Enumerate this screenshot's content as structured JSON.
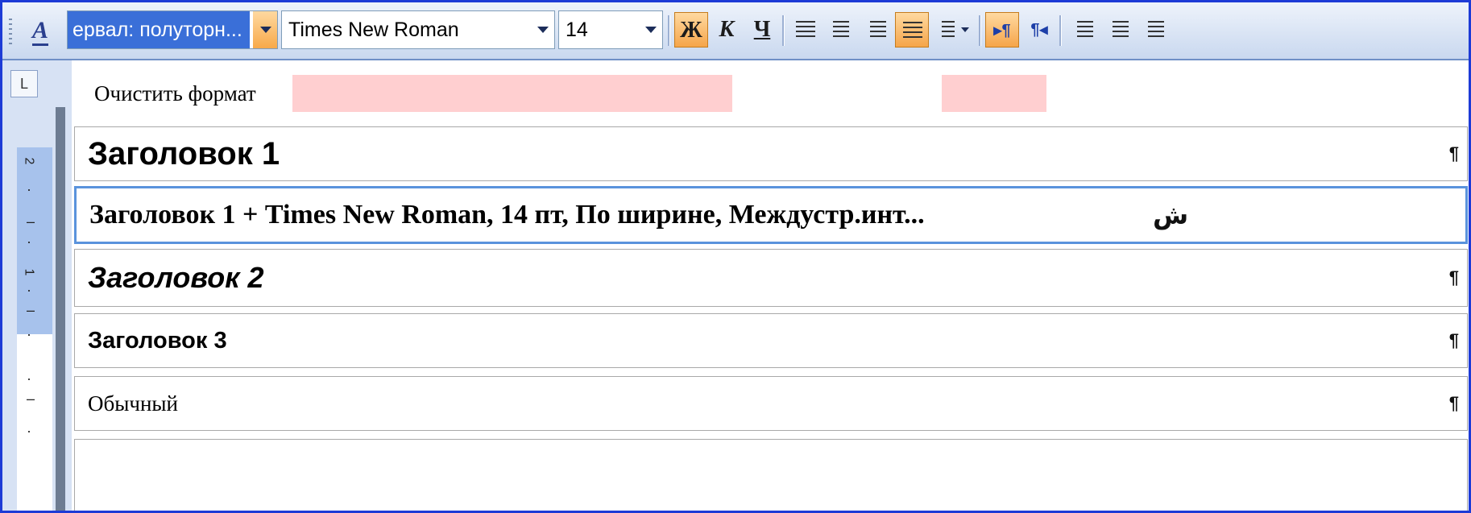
{
  "toolbar": {
    "style_value": "ервал: полуторн...",
    "font_value": "Times New Roman",
    "size_value": "14",
    "bold_label": "Ж",
    "italic_label": "К",
    "underline_label": "Ч",
    "ltr_label": "▸¶",
    "rtl_label": "¶◂",
    "styles_icon": "A",
    "bold_active": true,
    "justify_active": true,
    "ltr_active": true
  },
  "ruler": {
    "tab_selector": "L",
    "numbers": [
      "2",
      "1"
    ]
  },
  "styles_list": {
    "clear_format": "Очистить формат",
    "items": [
      {
        "label": "Заголовок 1",
        "mark": "¶"
      },
      {
        "label": "Заголовок 1 + Times New Roman, 14 пт, По ширине, Междустр.инт...",
        "mark": "ش"
      },
      {
        "label": "Заголовок 2",
        "mark": "¶"
      },
      {
        "label": "Заголовок 3",
        "mark": "¶"
      },
      {
        "label": "Обычный",
        "mark": "¶"
      }
    ]
  },
  "colors": {
    "frame": "#1d3bd6",
    "toolbar_active": "#f5a54a",
    "selection": "#3a6fd8",
    "highlight": "#ffcfd0"
  }
}
